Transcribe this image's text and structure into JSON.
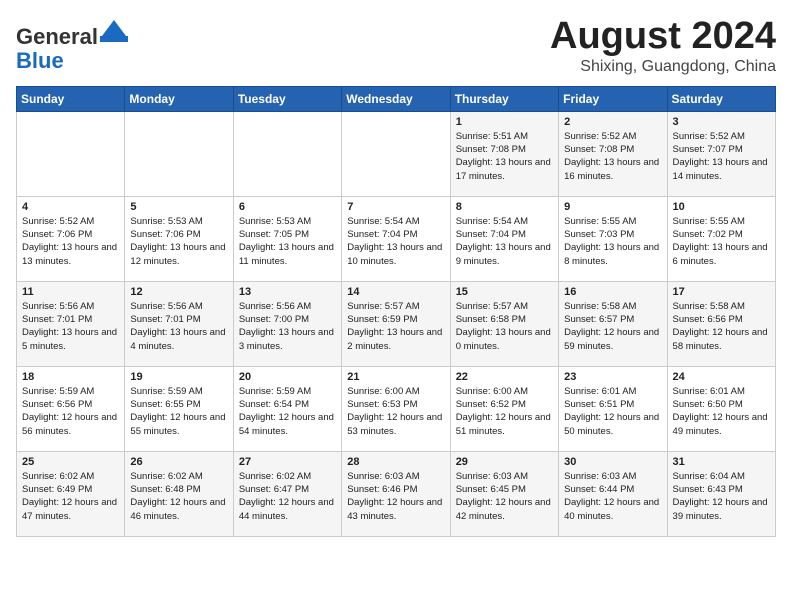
{
  "header": {
    "logo_line1": "General",
    "logo_line2": "Blue",
    "month_year": "August 2024",
    "location": "Shixing, Guangdong, China"
  },
  "days_of_week": [
    "Sunday",
    "Monday",
    "Tuesday",
    "Wednesday",
    "Thursday",
    "Friday",
    "Saturday"
  ],
  "weeks": [
    [
      {
        "day": "",
        "info": ""
      },
      {
        "day": "",
        "info": ""
      },
      {
        "day": "",
        "info": ""
      },
      {
        "day": "",
        "info": ""
      },
      {
        "day": "1",
        "info": "Sunrise: 5:51 AM\nSunset: 7:08 PM\nDaylight: 13 hours\nand 17 minutes."
      },
      {
        "day": "2",
        "info": "Sunrise: 5:52 AM\nSunset: 7:08 PM\nDaylight: 13 hours\nand 16 minutes."
      },
      {
        "day": "3",
        "info": "Sunrise: 5:52 AM\nSunset: 7:07 PM\nDaylight: 13 hours\nand 14 minutes."
      }
    ],
    [
      {
        "day": "4",
        "info": "Sunrise: 5:52 AM\nSunset: 7:06 PM\nDaylight: 13 hours\nand 13 minutes."
      },
      {
        "day": "5",
        "info": "Sunrise: 5:53 AM\nSunset: 7:06 PM\nDaylight: 13 hours\nand 12 minutes."
      },
      {
        "day": "6",
        "info": "Sunrise: 5:53 AM\nSunset: 7:05 PM\nDaylight: 13 hours\nand 11 minutes."
      },
      {
        "day": "7",
        "info": "Sunrise: 5:54 AM\nSunset: 7:04 PM\nDaylight: 13 hours\nand 10 minutes."
      },
      {
        "day": "8",
        "info": "Sunrise: 5:54 AM\nSunset: 7:04 PM\nDaylight: 13 hours\nand 9 minutes."
      },
      {
        "day": "9",
        "info": "Sunrise: 5:55 AM\nSunset: 7:03 PM\nDaylight: 13 hours\nand 8 minutes."
      },
      {
        "day": "10",
        "info": "Sunrise: 5:55 AM\nSunset: 7:02 PM\nDaylight: 13 hours\nand 6 minutes."
      }
    ],
    [
      {
        "day": "11",
        "info": "Sunrise: 5:56 AM\nSunset: 7:01 PM\nDaylight: 13 hours\nand 5 minutes."
      },
      {
        "day": "12",
        "info": "Sunrise: 5:56 AM\nSunset: 7:01 PM\nDaylight: 13 hours\nand 4 minutes."
      },
      {
        "day": "13",
        "info": "Sunrise: 5:56 AM\nSunset: 7:00 PM\nDaylight: 13 hours\nand 3 minutes."
      },
      {
        "day": "14",
        "info": "Sunrise: 5:57 AM\nSunset: 6:59 PM\nDaylight: 13 hours\nand 2 minutes."
      },
      {
        "day": "15",
        "info": "Sunrise: 5:57 AM\nSunset: 6:58 PM\nDaylight: 13 hours\nand 0 minutes."
      },
      {
        "day": "16",
        "info": "Sunrise: 5:58 AM\nSunset: 6:57 PM\nDaylight: 12 hours\nand 59 minutes."
      },
      {
        "day": "17",
        "info": "Sunrise: 5:58 AM\nSunset: 6:56 PM\nDaylight: 12 hours\nand 58 minutes."
      }
    ],
    [
      {
        "day": "18",
        "info": "Sunrise: 5:59 AM\nSunset: 6:56 PM\nDaylight: 12 hours\nand 56 minutes."
      },
      {
        "day": "19",
        "info": "Sunrise: 5:59 AM\nSunset: 6:55 PM\nDaylight: 12 hours\nand 55 minutes."
      },
      {
        "day": "20",
        "info": "Sunrise: 5:59 AM\nSunset: 6:54 PM\nDaylight: 12 hours\nand 54 minutes."
      },
      {
        "day": "21",
        "info": "Sunrise: 6:00 AM\nSunset: 6:53 PM\nDaylight: 12 hours\nand 53 minutes."
      },
      {
        "day": "22",
        "info": "Sunrise: 6:00 AM\nSunset: 6:52 PM\nDaylight: 12 hours\nand 51 minutes."
      },
      {
        "day": "23",
        "info": "Sunrise: 6:01 AM\nSunset: 6:51 PM\nDaylight: 12 hours\nand 50 minutes."
      },
      {
        "day": "24",
        "info": "Sunrise: 6:01 AM\nSunset: 6:50 PM\nDaylight: 12 hours\nand 49 minutes."
      }
    ],
    [
      {
        "day": "25",
        "info": "Sunrise: 6:02 AM\nSunset: 6:49 PM\nDaylight: 12 hours\nand 47 minutes."
      },
      {
        "day": "26",
        "info": "Sunrise: 6:02 AM\nSunset: 6:48 PM\nDaylight: 12 hours\nand 46 minutes."
      },
      {
        "day": "27",
        "info": "Sunrise: 6:02 AM\nSunset: 6:47 PM\nDaylight: 12 hours\nand 44 minutes."
      },
      {
        "day": "28",
        "info": "Sunrise: 6:03 AM\nSunset: 6:46 PM\nDaylight: 12 hours\nand 43 minutes."
      },
      {
        "day": "29",
        "info": "Sunrise: 6:03 AM\nSunset: 6:45 PM\nDaylight: 12 hours\nand 42 minutes."
      },
      {
        "day": "30",
        "info": "Sunrise: 6:03 AM\nSunset: 6:44 PM\nDaylight: 12 hours\nand 40 minutes."
      },
      {
        "day": "31",
        "info": "Sunrise: 6:04 AM\nSunset: 6:43 PM\nDaylight: 12 hours\nand 39 minutes."
      }
    ]
  ]
}
